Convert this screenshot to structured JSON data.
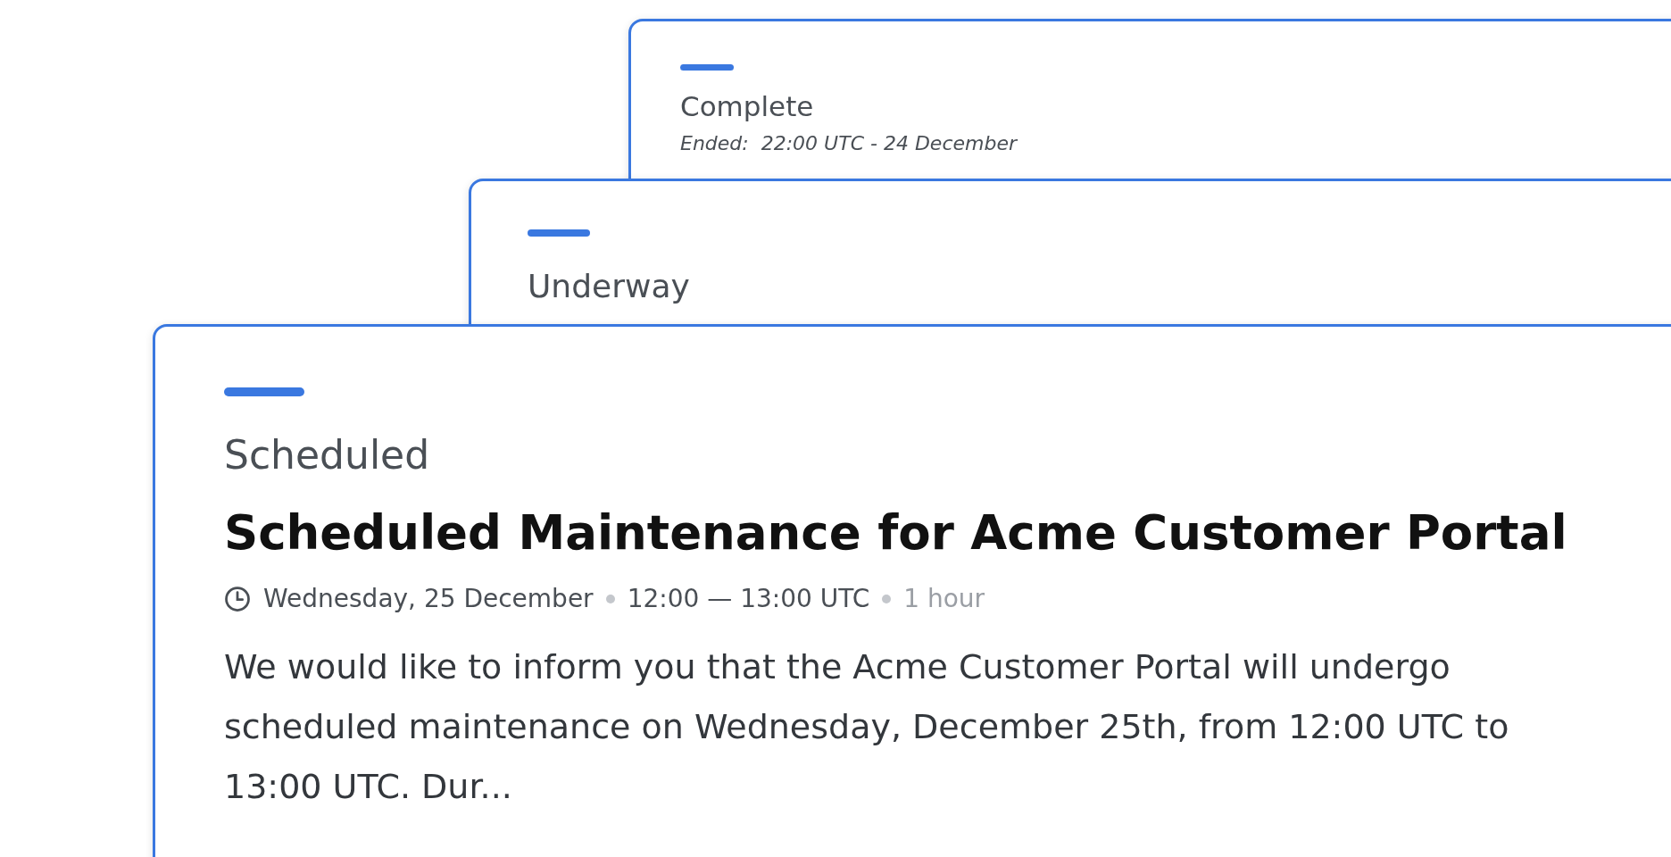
{
  "cards": [
    {
      "status": "Complete",
      "ended": "Ended:  22:00 UTC - 24 December"
    },
    {
      "status": "Underway"
    },
    {
      "status": "Scheduled",
      "title": "Scheduled Maintenance for Acme Customer Portal",
      "meta": [
        {
          "kind": "date",
          "text": "Wednesday, 25 December"
        },
        {
          "kind": "time",
          "text": "12:00 — 13:00 UTC"
        },
        {
          "kind": "duration",
          "text": "1 hour"
        }
      ],
      "description": "We would like to inform you that the Acme Customer Portal will undergo scheduled maintenance on Wednesday, December 25th, from 12:00 UTC to 13:00 UTC. Dur..."
    }
  ]
}
